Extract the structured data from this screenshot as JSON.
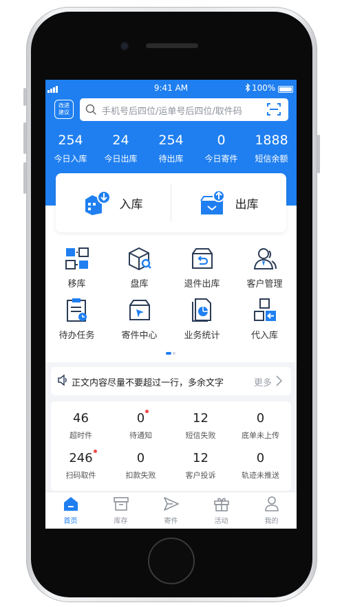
{
  "status_bar": {
    "time": "9:41 AM",
    "battery": "100%"
  },
  "header": {
    "feedback_label_1": "改进",
    "feedback_label_2": "建议",
    "search_placeholder": "手机号后四位/运单号后四位/取件码"
  },
  "stats": [
    {
      "value": "254",
      "label": "今日入库"
    },
    {
      "value": "24",
      "label": "今日出库"
    },
    {
      "value": "254",
      "label": "待出库"
    },
    {
      "value": "0",
      "label": "今日寄件"
    },
    {
      "value": "1888",
      "label": "短信余额"
    }
  ],
  "io": {
    "in_label": "入库",
    "out_label": "出库"
  },
  "menu": [
    {
      "label": "移库",
      "icon": "move-stock-icon"
    },
    {
      "label": "盘库",
      "icon": "inventory-check-icon"
    },
    {
      "label": "退件出库",
      "icon": "return-out-icon"
    },
    {
      "label": "客户管理",
      "icon": "customer-icon"
    },
    {
      "label": "待办任务",
      "icon": "task-icon"
    },
    {
      "label": "寄件中心",
      "icon": "send-center-icon"
    },
    {
      "label": "业务统计",
      "icon": "statistics-icon"
    },
    {
      "label": "代入库",
      "icon": "proxy-in-icon"
    }
  ],
  "notice": {
    "text": "正文内容尽量不要超过一行，多余文字",
    "more": "更多"
  },
  "counters": [
    {
      "value": "46",
      "label": "超时件",
      "dot": false
    },
    {
      "value": "0",
      "label": "待通知",
      "dot": true
    },
    {
      "value": "12",
      "label": "短信失败",
      "dot": false
    },
    {
      "value": "0",
      "label": "底单未上传",
      "dot": false
    },
    {
      "value": "246",
      "label": "扫码取件",
      "dot": true
    },
    {
      "value": "0",
      "label": "扣款失败",
      "dot": false
    },
    {
      "value": "12",
      "label": "客户投诉",
      "dot": false
    },
    {
      "value": "0",
      "label": "轨迹未推送",
      "dot": false
    }
  ],
  "tabs": [
    {
      "label": "首页",
      "icon": "home-icon",
      "active": true
    },
    {
      "label": "库存",
      "icon": "box-icon",
      "active": false
    },
    {
      "label": "寄件",
      "icon": "send-icon",
      "active": false
    },
    {
      "label": "活动",
      "icon": "gift-icon",
      "active": false
    },
    {
      "label": "我的",
      "icon": "profile-icon",
      "active": false
    }
  ],
  "colors": {
    "primary": "#1f7ff0",
    "badge": "#f04848",
    "background": "#f2f4f7"
  }
}
